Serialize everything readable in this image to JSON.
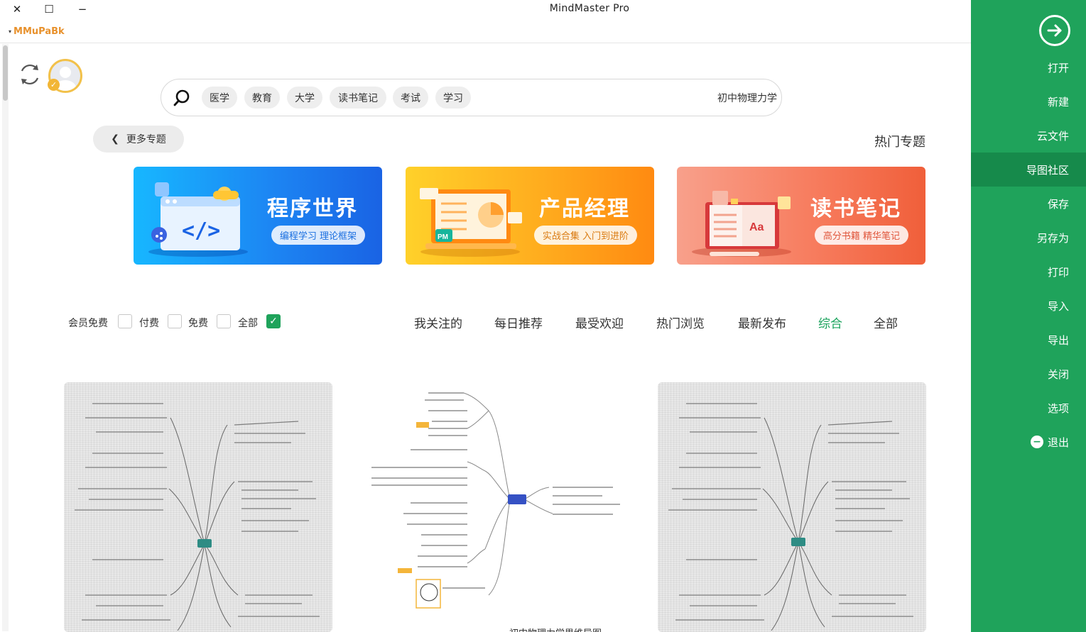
{
  "window": {
    "title": "MindMaster Pro",
    "close_glyph": "✕",
    "maximize_glyph": "☐",
    "minimize_glyph": "−",
    "user_name": "MMuPaBk",
    "user_caret": "▾"
  },
  "search": {
    "value": "初中物理力学",
    "tags": [
      "学习",
      "考试",
      "读书笔记",
      "大学",
      "教育",
      "医学"
    ]
  },
  "hot_topics": {
    "title": "热门专题",
    "more_label": "更多专题",
    "more_icon": "chevron-left-icon",
    "banners": [
      {
        "title": "读书笔记",
        "subtitle": "高分书籍 精华笔记",
        "color": "#f56f4b"
      },
      {
        "title": "产品经理",
        "subtitle": "实战合集 入门到进阶",
        "color": "#ffa01c"
      },
      {
        "title": "程序世界",
        "subtitle": "编程学习 理论框架",
        "color": "#1c86f3"
      }
    ]
  },
  "filter_tabs": {
    "active": "综合",
    "items": [
      "全部",
      "综合",
      "最新发布",
      "热门浏览",
      "最受欢迎",
      "每日推荐",
      "我关注的"
    ]
  },
  "price_filters": [
    {
      "label": "全部",
      "checked": true
    },
    {
      "label": "免费",
      "checked": false
    },
    {
      "label": "付费",
      "checked": false
    },
    {
      "label": "会员免费",
      "checked": false
    }
  ],
  "cards": {
    "middle_caption": "初中物理力学思维导图"
  },
  "sidebar": {
    "active": "导图社区",
    "back_icon": "arrow-right-circle-icon",
    "items": [
      "打开",
      "新建",
      "云文件",
      "导图社区",
      "保存",
      "另存为",
      "打印",
      "导入",
      "导出",
      "关闭",
      "选项",
      "退出"
    ],
    "exit_glyph": "−",
    "color": "#1fa35b"
  }
}
